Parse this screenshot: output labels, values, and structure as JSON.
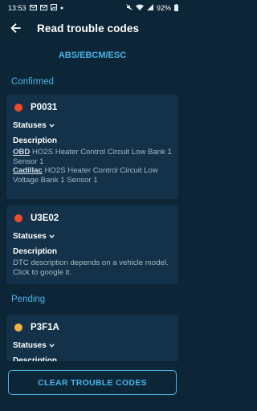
{
  "status_bar": {
    "time": "13:53",
    "battery": "92%",
    "left_icons": [
      "gmail-icon",
      "gmail-icon",
      "image-icon",
      "dot-icon"
    ],
    "right_icons": [
      "wifi-icon",
      "signal-icon",
      "battery-icon"
    ]
  },
  "app_bar": {
    "back_icon": "arrow-left-icon",
    "title": "Read trouble codes"
  },
  "module": "ABS/EBCM/ESC",
  "sections": {
    "confirmed": "Confirmed",
    "pending": "Pending"
  },
  "codes": [
    {
      "code": "P0031",
      "dot_color": "#f04a2e",
      "statuses_label": "Statuses",
      "description_label": "Description",
      "descriptions": [
        {
          "make": "OBD",
          "text": "HO2S Heater Control Circuit Low Bank 1 Sensor 1"
        },
        {
          "make": "Cadillac",
          "text": "HO2S Heater Control Circuit Low Voltage Bank 1 Sensor 1"
        }
      ]
    },
    {
      "code": "U3E02",
      "dot_color": "#f04a2e",
      "statuses_label": "Statuses",
      "description_label": "Description",
      "description_text": "DTC description depends on a vehicle model. Click to google it."
    },
    {
      "code": "P3F1A",
      "dot_color": "#f2b33d",
      "statuses_label": "Statuses",
      "description_label": "Description"
    }
  ],
  "clear_button": "CLEAR TROUBLE CODES",
  "colors": {
    "background": "#0c2638",
    "card": "#133249",
    "accent": "#4ab3e8"
  }
}
